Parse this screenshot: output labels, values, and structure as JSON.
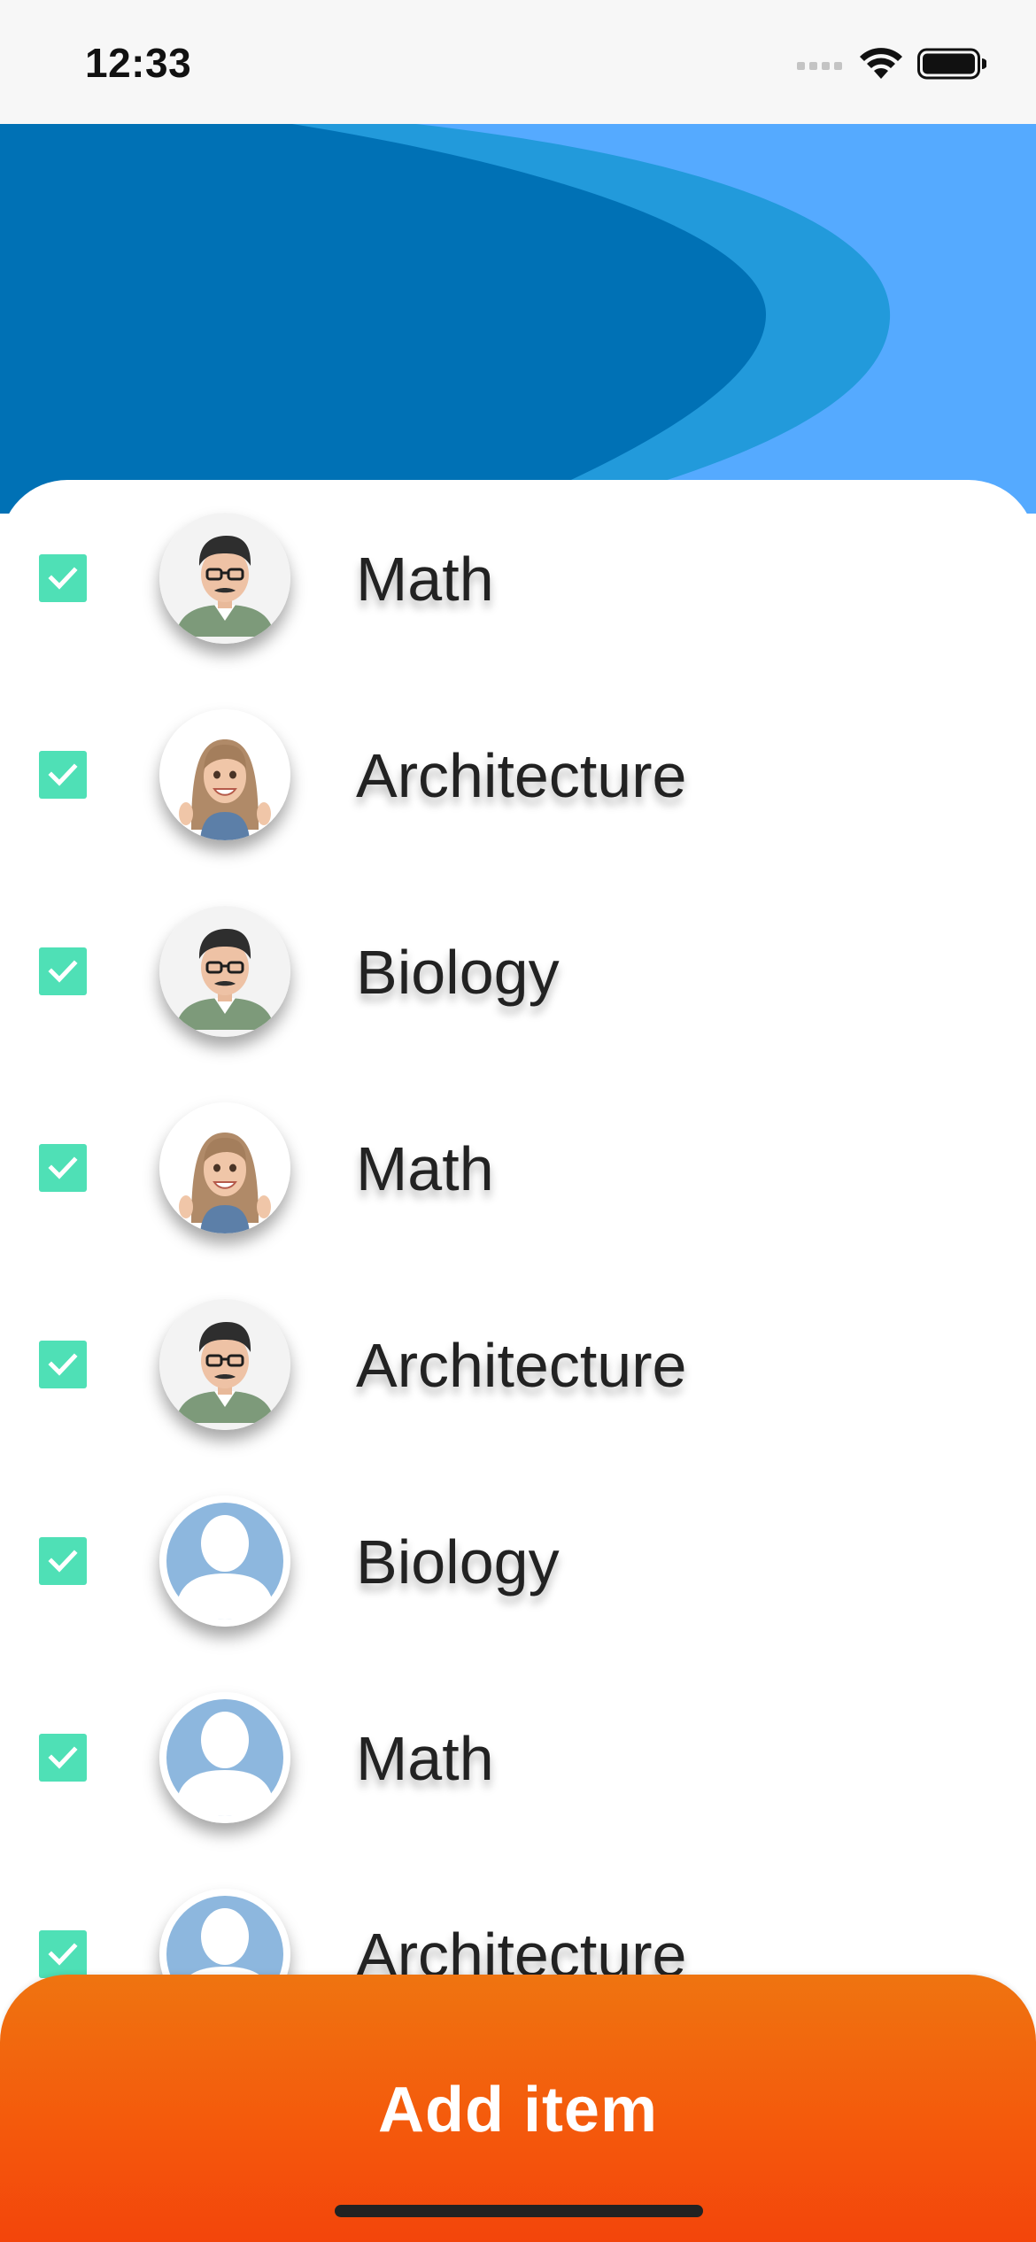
{
  "status_bar": {
    "time": "12:33",
    "icons": [
      "cellular-signal-icon",
      "wifi-icon",
      "battery-icon"
    ]
  },
  "header": {
    "colors": {
      "background": "#55aaff",
      "mid_band": "#229adb",
      "dark_band": "#0071b5"
    }
  },
  "list": {
    "items": [
      {
        "label": "Math",
        "checked": true,
        "avatar": "man-glasses-avatar"
      },
      {
        "label": "Architecture",
        "checked": true,
        "avatar": "woman-avatar"
      },
      {
        "label": "Biology",
        "checked": true,
        "avatar": "man-glasses-avatar"
      },
      {
        "label": "Math",
        "checked": true,
        "avatar": "woman-avatar"
      },
      {
        "label": "Architecture",
        "checked": true,
        "avatar": "man-glasses-avatar"
      },
      {
        "label": "Biology",
        "checked": true,
        "avatar": "default-person-avatar"
      },
      {
        "label": "Math",
        "checked": true,
        "avatar": "default-person-avatar"
      },
      {
        "label": "Architecture",
        "checked": true,
        "avatar": "default-person-avatar"
      }
    ],
    "checkbox_color": "#4fe0b6"
  },
  "add_button": {
    "label": "Add item",
    "gradient_colors": [
      "#ef7410",
      "#f3450b"
    ]
  }
}
